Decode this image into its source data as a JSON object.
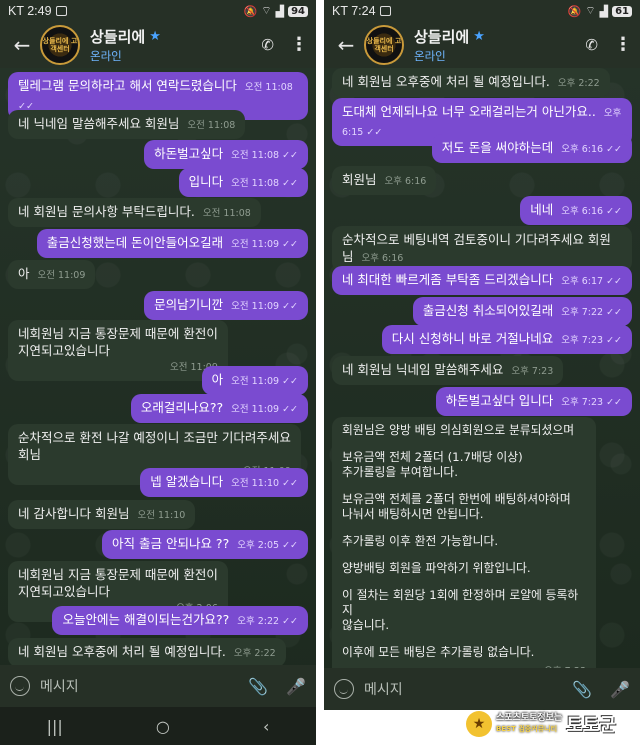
{
  "left": {
    "status": {
      "time": "KT 2:49",
      "battery": "94"
    },
    "header": {
      "name": "상들리에",
      "status": "온라인",
      "avatar_text": "상들리에 고객센터"
    },
    "messages": [
      {
        "dir": "out",
        "text": "텔레그램 문의하라고 해서 연락드렸습니다",
        "time": "오전 11:08 ✓✓"
      },
      {
        "dir": "in",
        "text": "네 닉네임 말씀해주세요 회원님",
        "time": "오전 11:08"
      },
      {
        "dir": "out",
        "text": "하돈벌고싶다",
        "time": "오전 11:08 ✓✓"
      },
      {
        "dir": "out",
        "text": "입니다",
        "time": "오전 11:08 ✓✓"
      },
      {
        "dir": "in",
        "text": "네 회원님 문의사항 부탁드립니다.",
        "time": "오전 11:08"
      },
      {
        "dir": "out",
        "text": "출금신청했는데 돈이안들어오길래",
        "time": "오전 11:09 ✓✓"
      },
      {
        "dir": "in",
        "text": "아",
        "time": "오전 11:09"
      },
      {
        "dir": "out",
        "text": "문의남기니깐",
        "time": "오전 11:09 ✓✓"
      },
      {
        "dir": "in",
        "lines": [
          "네회원님 지금 통장문제 때문에 환전이",
          "지연되고있습니다"
        ],
        "time": "오전 11:09"
      },
      {
        "dir": "out",
        "text": "아",
        "time": "오전 11:09 ✓✓"
      },
      {
        "dir": "out",
        "text": "오래걸리나요??",
        "time": "오전 11:09 ✓✓"
      },
      {
        "dir": "in",
        "lines": [
          "순차적으로 환전 나갈 예정이니 조금만 기다려주세요",
          "회님"
        ],
        "time": "오전 11:09"
      },
      {
        "dir": "out",
        "text": "넵 알겠습니다",
        "time": "오전 11:10 ✓✓"
      },
      {
        "dir": "in",
        "text": "네 감사합니다 회원님",
        "time": "오전 11:10"
      },
      {
        "dir": "out",
        "text": "아직 출금 안되나요 ??",
        "time": "오후 2:05 ✓✓"
      },
      {
        "dir": "in",
        "lines": [
          "네회원님 지금 통장문제 때문에 환전이",
          "지연되고있습니다"
        ],
        "time": "오후 2:06"
      },
      {
        "dir": "out",
        "text": "오늘안에는 해결이되는건가요??",
        "time": "오후 2:22 ✓✓"
      },
      {
        "dir": "in",
        "text": "네 회원님 오후중에 처리 될 예정입니다.",
        "time": "오후 2:22"
      }
    ],
    "composer": {
      "placeholder": "메시지"
    }
  },
  "right": {
    "status": {
      "time": "KT 7:24",
      "battery": "61"
    },
    "header": {
      "name": "상들리에",
      "status": "온라인",
      "avatar_text": "상들리에 고객센터"
    },
    "messages": [
      {
        "dir": "in",
        "text": "네 회원님 오후중에 처리 될 예정입니다.",
        "time": "오후 2:22"
      },
      {
        "dir": "out",
        "text": "도대체 언제되나요 너무 오래걸리는거 아닌가요..",
        "time": "오후 6:15 ✓✓"
      },
      {
        "dir": "out",
        "text": "저도 돈을 써야하는데",
        "time": "오후 6:16 ✓✓"
      },
      {
        "dir": "in",
        "text": "회원님",
        "time": "오후 6:16"
      },
      {
        "dir": "out",
        "text": "네네",
        "time": "오후 6:16 ✓✓"
      },
      {
        "dir": "in",
        "text": "순차적으로 베팅내역 검토중이니 기다려주세요 회원님",
        "time": "오후 6:16"
      },
      {
        "dir": "out",
        "text": "네 최대한 빠르게좀 부탁좀 드리겠습니다",
        "time": "오후 6:17 ✓✓"
      },
      {
        "dir": "out",
        "text": "출금신청 취소되어있길래",
        "time": "오후 7:22 ✓✓"
      },
      {
        "dir": "out",
        "text": "다시 신청하니 바로 거절나네요",
        "time": "오후 7:23 ✓✓"
      },
      {
        "dir": "in",
        "text": "네 회원님 닉네임 말씀해주세요",
        "time": "오후 7:23"
      },
      {
        "dir": "out",
        "text": "하돈벌고싶다 입니다",
        "time": "오후 7:23 ✓✓"
      }
    ],
    "long_message": {
      "paragraphs": [
        "회원님은 양방 배팅 의심회원으로 분류되셨으며",
        "보유금액 전체 2폴더 (1.7배당 이상)\n추가롤링을 부여합니다.",
        "보유금액 전체를 2폴더 한번에 배팅하셔야하며\n나눠서 배팅하시면 안됩니다.",
        "추가롤링 이후 환전 가능합니다.",
        "양방배팅 회원을 파악하기 위함입니다.",
        "이 절차는 회원당 1회에 한정하며 로얄에 등록하지\n않습니다.",
        "이후에 모든 배팅은 추가롤링 없습니다."
      ],
      "time": "오후 7:23"
    },
    "composer": {
      "placeholder": "메시지"
    }
  },
  "watermark": {
    "line1": "스포츠토토정보는",
    "line2": "BEST 검증커뮤니티",
    "brand": "토토군"
  }
}
